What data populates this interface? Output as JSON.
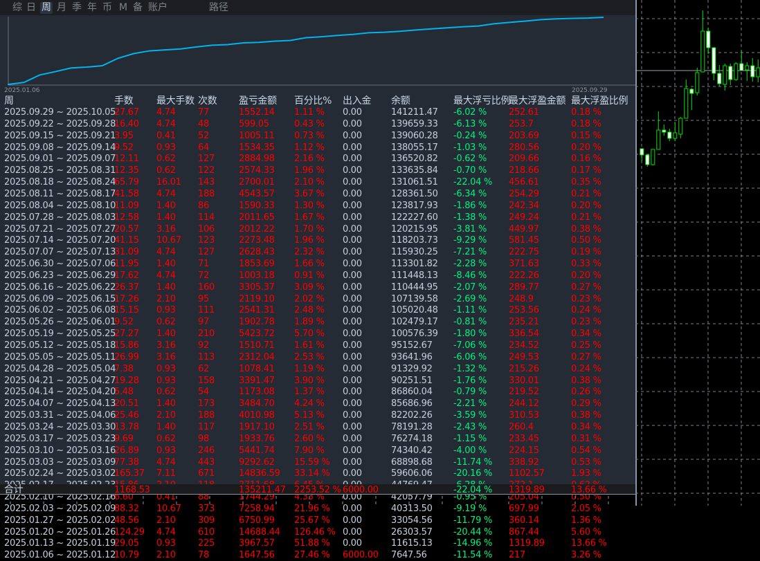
{
  "tabs": [
    "综",
    "日",
    "周",
    "月",
    "季",
    "年",
    "币",
    "M",
    "备",
    "账户",
    "路径"
  ],
  "active_tab": "周",
  "chart": {
    "start_label": "2025.01.06",
    "end_label": "2025.09.29",
    "line_color": "#00b4f0"
  },
  "headers": [
    "周",
    "手数",
    "最大手数",
    "次数",
    "盈亏金额",
    "百分比%",
    "出入金",
    "余额",
    "最大浮亏比例",
    "最大浮盈金额",
    "最大浮盈比例"
  ],
  "rows": [
    [
      "2025.09.29 ~ 2025.10.05",
      "27.67",
      "4.74",
      "77",
      "1552.14",
      "1.11 %",
      "0.00",
      "141211.47",
      "-6.02 %",
      "252.61",
      "0.18 %"
    ],
    [
      "2025.09.22 ~ 2025.09.28",
      "16.40",
      "4.74",
      "48",
      "599.05",
      "0.43 %",
      "0.00",
      "139659.33",
      "-6.13 %",
      "253.7",
      "0.18 %"
    ],
    [
      "2025.09.15 ~ 2025.09.21",
      "3.95",
      "0.41",
      "52",
      "1005.11",
      "0.73 %",
      "0.00",
      "139060.28",
      "-0.24 %",
      "203.69",
      "0.15 %"
    ],
    [
      "2025.09.08 ~ 2025.09.14",
      "9.52",
      "0.93",
      "64",
      "1534.35",
      "1.12 %",
      "0.00",
      "138055.17",
      "-1.03 %",
      "280.56",
      "0.20 %"
    ],
    [
      "2025.09.01 ~ 2025.09.07",
      "12.11",
      "0.62",
      "127",
      "2884.98",
      "2.16 %",
      "0.00",
      "136520.82",
      "-0.62 %",
      "209.66",
      "0.16 %"
    ],
    [
      "2025.08.25 ~ 2025.08.31",
      "12.35",
      "0.62",
      "122",
      "2574.33",
      "1.96 %",
      "0.00",
      "133635.84",
      "-0.70 %",
      "218.66",
      "0.17 %"
    ],
    [
      "2025.08.18 ~ 2025.08.24",
      "65.79",
      "16.01",
      "143",
      "2700.01",
      "2.10 %",
      "0.00",
      "131061.51",
      "-22.04 %",
      "456.61",
      "0.35 %"
    ],
    [
      "2025.08.11 ~ 2025.08.17",
      "41.58",
      "4.74",
      "188",
      "4543.57",
      "3.67 %",
      "0.00",
      "128361.50",
      "-6.34 %",
      "254.29",
      "0.21 %"
    ],
    [
      "2025.08.04 ~ 2025.08.10",
      "11.09",
      "1.40",
      "86",
      "1590.33",
      "1.30 %",
      "0.00",
      "123817.93",
      "-1.86 %",
      "242.34",
      "0.20 %"
    ],
    [
      "2025.07.28 ~ 2025.08.03",
      "12.58",
      "1.40",
      "114",
      "2011.65",
      "1.67 %",
      "0.00",
      "122227.60",
      "-1.38 %",
      "249.24",
      "0.21 %"
    ],
    [
      "2025.07.21 ~ 2025.07.27",
      "20.57",
      "3.16",
      "106",
      "2012.22",
      "1.70 %",
      "0.00",
      "120215.95",
      "-3.81 %",
      "449.97",
      "0.38 %"
    ],
    [
      "2025.07.14 ~ 2025.07.20",
      "41.15",
      "10.67",
      "123",
      "2273.48",
      "1.96 %",
      "0.00",
      "118203.73",
      "-9.29 %",
      "581.45",
      "0.50 %"
    ],
    [
      "2025.07.07 ~ 2025.07.13",
      "31.09",
      "4.74",
      "127",
      "2628.43",
      "2.32 %",
      "0.00",
      "115930.25",
      "-7.21 %",
      "222.75",
      "0.19 %"
    ],
    [
      "2025.06.30 ~ 2025.07.06",
      "11.95",
      "1.40",
      "71",
      "1853.69",
      "1.66 %",
      "0.00",
      "113301.82",
      "-2.28 %",
      "371.63",
      "0.33 %"
    ],
    [
      "2025.06.23 ~ 2025.06.29",
      "17.62",
      "4.74",
      "72",
      "1003.18",
      "0.91 %",
      "0.00",
      "111448.13",
      "-8.46 %",
      "222.26",
      "0.20 %"
    ],
    [
      "2025.06.16 ~ 2025.06.22",
      "26.37",
      "1.40",
      "160",
      "3305.37",
      "3.09 %",
      "0.00",
      "110444.95",
      "-2.07 %",
      "289.77",
      "0.27 %"
    ],
    [
      "2025.06.09 ~ 2025.06.15",
      "17.26",
      "2.10",
      "95",
      "2119.10",
      "2.02 %",
      "0.00",
      "107139.58",
      "-2.69 %",
      "248.9",
      "0.23 %"
    ],
    [
      "2025.06.02 ~ 2025.06.08",
      "15.15",
      "0.93",
      "111",
      "2541.31",
      "2.48 %",
      "0.00",
      "105020.48",
      "-1.11 %",
      "253.56",
      "0.24 %"
    ],
    [
      "2025.05.26 ~ 2025.06.01",
      "9.52",
      "0.62",
      "97",
      "1902.78",
      "1.89 %",
      "0.00",
      "102479.17",
      "-0.81 %",
      "235.21",
      "0.23 %"
    ],
    [
      "2025.05.19 ~ 2025.05.25",
      "27.27",
      "1.40",
      "210",
      "5423.72",
      "5.70 %",
      "0.00",
      "100576.39",
      "-1.80 %",
      "336.54",
      "0.34 %"
    ],
    [
      "2025.05.12 ~ 2025.05.18",
      "15.86",
      "3.16",
      "92",
      "1510.71",
      "1.61 %",
      "0.00",
      "95152.67",
      "-7.06 %",
      "234.52",
      "0.25 %"
    ],
    [
      "2025.05.05 ~ 2025.05.11",
      "26.99",
      "3.16",
      "113",
      "2312.04",
      "2.53 %",
      "0.00",
      "93641.96",
      "-6.06 %",
      "249.53",
      "0.27 %"
    ],
    [
      "2025.04.28 ~ 2025.05.04",
      "7.38",
      "0.93",
      "62",
      "1078.41",
      "1.19 %",
      "0.00",
      "91329.92",
      "-1.32 %",
      "215.26",
      "0.24 %"
    ],
    [
      "2025.04.21 ~ 2025.04.27",
      "19.28",
      "0.93",
      "158",
      "3391.47",
      "3.90 %",
      "0.00",
      "90251.51",
      "-1.76 %",
      "330.01",
      "0.38 %"
    ],
    [
      "2025.04.14 ~ 2025.04.20",
      "5.48",
      "0.62",
      "54",
      "1173.08",
      "1.37 %",
      "0.00",
      "86860.04",
      "-0.79 %",
      "219.52",
      "0.26 %"
    ],
    [
      "2025.04.07 ~ 2025.04.13",
      "20.51",
      "1.40",
      "173",
      "3484.70",
      "4.24 %",
      "0.00",
      "85686.96",
      "-2.21 %",
      "244.12",
      "0.29 %"
    ],
    [
      "2025.03.31 ~ 2025.04.06",
      "25.46",
      "2.10",
      "188",
      "4010.98",
      "5.13 %",
      "0.00",
      "82202.26",
      "-3.59 %",
      "310.53",
      "0.38 %"
    ],
    [
      "2025.03.24 ~ 2025.03.30",
      "13.78",
      "1.40",
      "117",
      "1917.10",
      "2.51 %",
      "0.00",
      "78191.28",
      "-2.43 %",
      "260.4",
      "0.34 %"
    ],
    [
      "2025.03.17 ~ 2025.03.23",
      "9.69",
      "0.62",
      "98",
      "1933.76",
      "2.60 %",
      "0.00",
      "76274.18",
      "-1.15 %",
      "233.45",
      "0.31 %"
    ],
    [
      "2025.03.10 ~ 2025.03.16",
      "26.89",
      "0.93",
      "246",
      "5441.74",
      "7.90 %",
      "0.00",
      "74340.42",
      "-4.00 %",
      "224.15",
      "0.54 %"
    ],
    [
      "2025.03.03 ~ 2025.03.09",
      "77.38",
      "4.74",
      "443",
      "9292.62",
      "15.59 %",
      "0.00",
      "68898.68",
      "-11.74 %",
      "338.92",
      "0.53 %"
    ],
    [
      "2025.02.24 ~ 2025.03.02",
      "165.37",
      "7.11",
      "671",
      "14836.59",
      "33.14 %",
      "0.00",
      "59606.06",
      "-20.16 %",
      "1102.57",
      "1.93 %"
    ],
    [
      "2025.02.17 ~ 2025.02.23",
      "15.86",
      "2.10",
      "118",
      "2711.68",
      "6.45 %",
      "0.00",
      "44769.47",
      "-6.28 %",
      "272.1",
      "0.62 %"
    ],
    [
      "2025.02.10 ~ 2025.02.16",
      "6.60",
      "0.41",
      "88",
      "1744.29",
      "4.33 %",
      "0.00",
      "42057.79",
      "-0.95 %",
      "205.04",
      "0.50 %"
    ],
    [
      "2025.02.03 ~ 2025.02.09",
      "88.32",
      "10.67",
      "373",
      "7258.94",
      "21.96 %",
      "0.00",
      "40313.50",
      "-9.19 %",
      "697.99",
      "2.05 %"
    ],
    [
      "2025.01.27 ~ 2025.02.02",
      "48.56",
      "2.10",
      "309",
      "6750.99",
      "25.67 %",
      "0.00",
      "33054.56",
      "-11.79 %",
      "360.14",
      "1.36 %"
    ],
    [
      "2025.01.20 ~ 2025.01.26",
      "124.29",
      "4.74",
      "610",
      "14688.44",
      "126.46 %",
      "0.00",
      "26303.57",
      "-20.44 %",
      "867.44",
      "5.60 %"
    ],
    [
      "2025.01.13 ~ 2025.01.19",
      "29.05",
      "0.93",
      "225",
      "3967.57",
      "51.88 %",
      "0.00",
      "11615.13",
      "-14.96 %",
      "1319.89",
      "13.66 %"
    ],
    [
      "2025.01.06 ~ 2025.01.12",
      "10.79",
      "2.10",
      "78",
      "1647.56",
      "27.46 %",
      "6000.00",
      "7647.56",
      "-11.54 %",
      "217",
      "3.26 %"
    ]
  ],
  "total": [
    "合计",
    "1168.53",
    "",
    "",
    "135211.47",
    "2253.52 %",
    "6000.00",
    "",
    "-22.04 %",
    "1319.89",
    "13.66 %"
  ],
  "colors": {
    "text": "#c5cfdc",
    "loss": "#ff0000",
    "drawdown": "#00f080",
    "candle": "#00e000"
  }
}
